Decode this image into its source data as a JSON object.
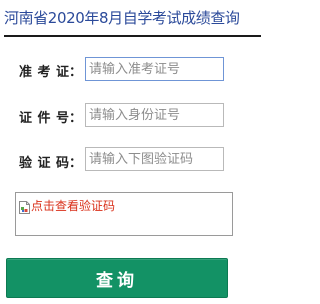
{
  "page_title": "河南省2020年8月自学考试成绩查询",
  "form": {
    "fields": [
      {
        "label": "准 考 证：",
        "placeholder": "请输入准考证号",
        "value": ""
      },
      {
        "label": "证 件 号：",
        "placeholder": "请输入身份证号",
        "value": ""
      },
      {
        "label": "验 证 码：",
        "placeholder": "请输入下图验证码",
        "value": ""
      }
    ],
    "captcha": {
      "text": "点击查看验证码",
      "icon": "broken-image-icon"
    },
    "submit_label": "查询"
  },
  "colors": {
    "title": "#2b4a9a",
    "captcha_text": "#d9301a",
    "button_bg": "#139265",
    "focus_border": "#6f95d6"
  }
}
